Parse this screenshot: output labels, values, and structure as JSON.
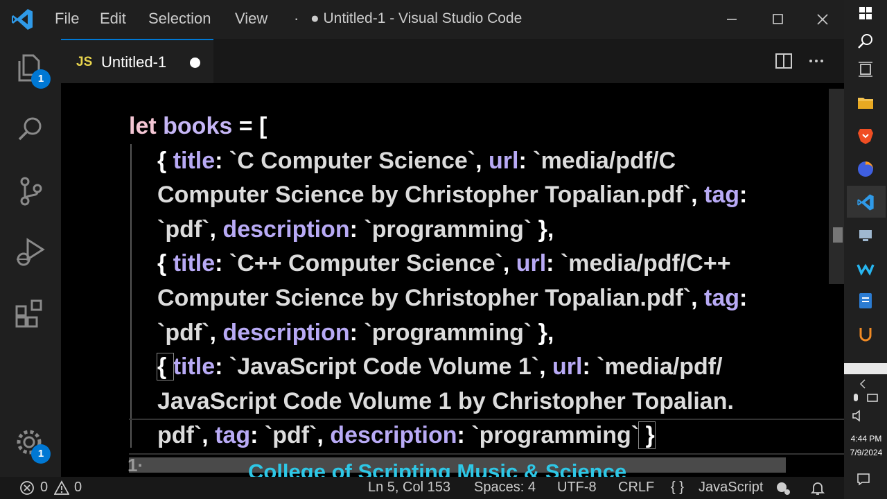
{
  "menu": {
    "file": "File",
    "edit": "Edit",
    "selection": "Selection",
    "view": "View",
    "more": "·"
  },
  "window_title": "● Untitled-1 - Visual Studio Code",
  "activity": {
    "explorer_badge": "1",
    "settings_badge": "1"
  },
  "tab": {
    "lang_icon": "JS",
    "label": "Untitled-1"
  },
  "code": {
    "l1": {
      "kw": "let",
      "var": "books",
      "op": " = ["
    },
    "l2": {
      "open": "{ ",
      "p1": "title",
      "c1": ": ",
      "s1": "`C Computer Science`",
      "c2": ", ",
      "p2": "url",
      "c3": ": ",
      "s2": "`media/pdf/C"
    },
    "l3": {
      "s": "Computer Science by Christopher Topalian.pdf`",
      "c1": ", ",
      "p": "tag",
      "c2": ":"
    },
    "l4": {
      "s1": "`pdf`",
      "c1": ", ",
      "p": "description",
      "c2": ": ",
      "s2": "`programming`",
      "close": " },"
    },
    "l5": {
      "open": "{ ",
      "p1": "title",
      "c1": ": ",
      "s1": "`C++ Computer Science`",
      "c2": ", ",
      "p2": "url",
      "c3": ": ",
      "s2": "`media/pdf/C++"
    },
    "l6": {
      "s": "Computer Science by Christopher Topalian.pdf`",
      "c1": ", ",
      "p": "tag",
      "c2": ":"
    },
    "l7": {
      "s1": "`pdf`",
      "c1": ", ",
      "p": "description",
      "c2": ": ",
      "s2": "`programming`",
      "close": " },"
    },
    "l8": {
      "open": "{ ",
      "p1": "title",
      "c1": ": ",
      "s1": "`JavaScript Code Volume 1`",
      "c2": ", ",
      "p2": "url",
      "c3": ": ",
      "s2": "`media/pdf/"
    },
    "l9": {
      "s": "JavaScript Code Volume 1 by Christopher Topalian."
    },
    "l10": {
      "s1": "pdf`",
      "c1": ", ",
      "p1": "tag",
      "c2": ": ",
      "s2": "`pdf`",
      "c3": ", ",
      "p2": "description",
      "c4": ": ",
      "s3": "`programming`",
      "close": " }"
    },
    "partial": "1·"
  },
  "caption": "College of Scripting Music & Science",
  "status": {
    "errors": "0",
    "warnings": "0",
    "position": "Ln 5, Col 153",
    "spaces": "Spaces: 4",
    "encoding": "UTF-8",
    "eol": "CRLF",
    "braces": "{ }",
    "language": "JavaScript"
  },
  "taskbar": {
    "time": "4:44 PM",
    "date": "7/9/2024"
  },
  "colors": {
    "accent": "#0078d4",
    "keyword": "#f4c6d4",
    "property": "#b8aaf5",
    "caption": "#2ec7e6"
  }
}
